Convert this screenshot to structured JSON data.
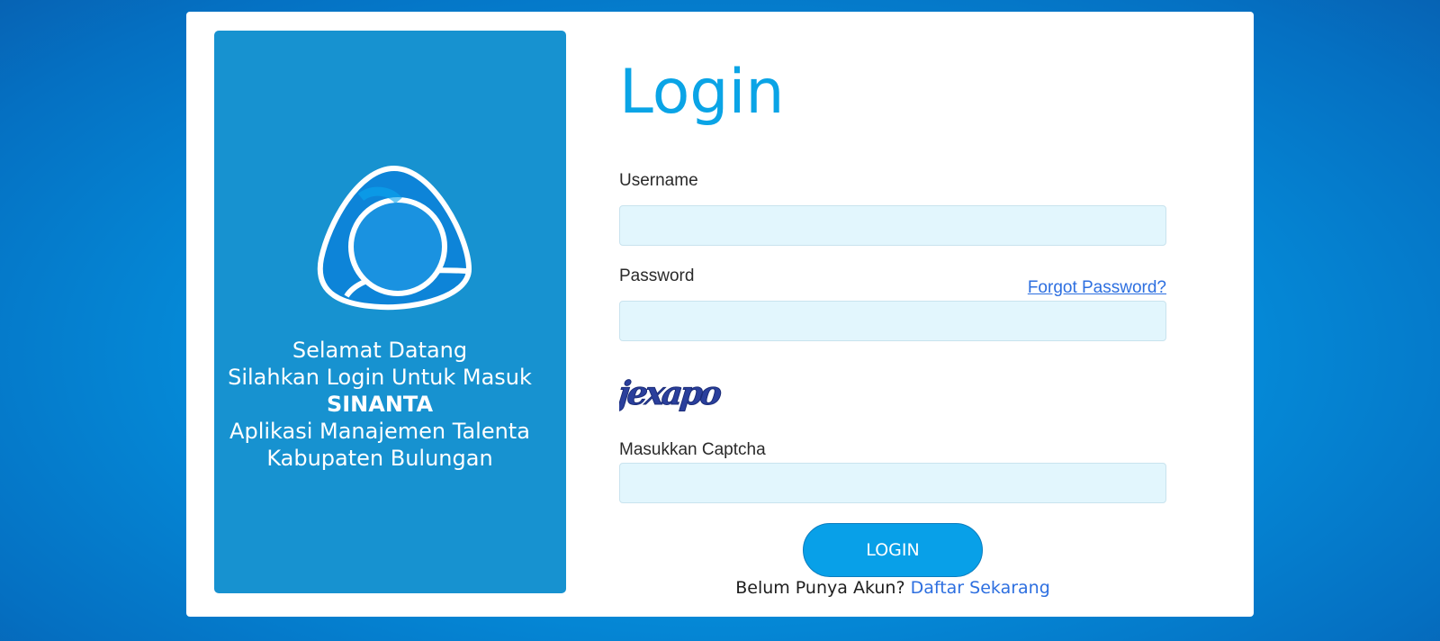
{
  "left_panel": {
    "welcome_line1": "Selamat Datang",
    "welcome_line2": "Silahkan Login Untuk Masuk",
    "app_name": "SINANTA",
    "welcome_line4": "Aplikasi Manajemen Talenta",
    "welcome_line5": "Kabupaten Bulungan"
  },
  "form": {
    "title": "Login",
    "username_label": "Username",
    "username_value": "",
    "password_label": "Password",
    "password_value": "",
    "forgot_label": "Forgot Password?",
    "captcha_text": "jexapo",
    "captcha_label": "Masukkan Captcha",
    "captcha_value": "",
    "login_button": "LOGIN",
    "register_prompt": "Belum Punya Akun?",
    "register_link": "Daftar Sekarang"
  },
  "colors": {
    "accent": "#0aa4e6",
    "panel": "#1792d0",
    "input_bg": "#e2f6fd",
    "link": "#2d6fe0"
  }
}
